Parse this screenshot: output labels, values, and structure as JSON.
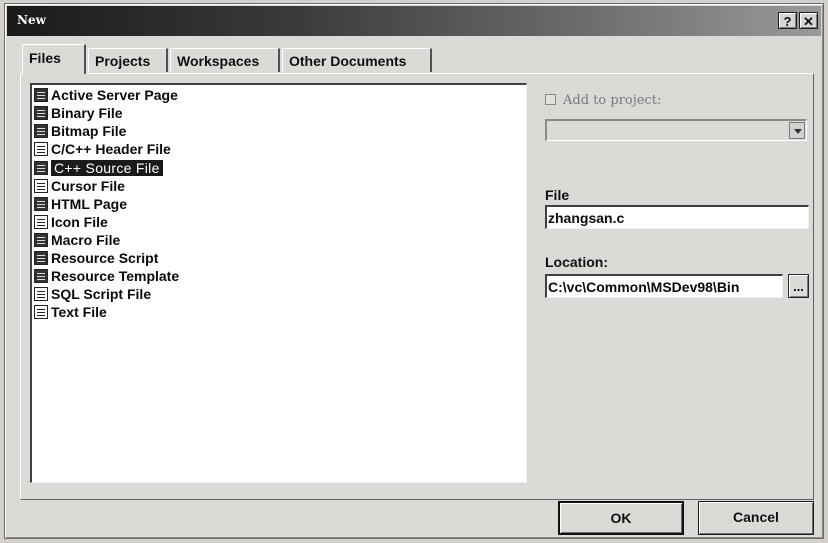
{
  "window": {
    "title": "New"
  },
  "titlebar_buttons": {
    "help": "?",
    "close": "✕"
  },
  "tabs": [
    {
      "label": "Files",
      "active": true
    },
    {
      "label": "Projects",
      "active": false
    },
    {
      "label": "Workspaces",
      "active": false
    },
    {
      "label": "Other Documents",
      "active": false
    }
  ],
  "files": [
    {
      "label": "Active Server Page",
      "icon": "asp-file-icon"
    },
    {
      "label": "Binary File",
      "icon": "binary-file-icon"
    },
    {
      "label": "Bitmap File",
      "icon": "bitmap-file-icon"
    },
    {
      "label": "C/C++ Header File",
      "icon": "header-file-icon"
    },
    {
      "label": "C++ Source File",
      "icon": "cpp-source-file-icon",
      "selected": true
    },
    {
      "label": "Cursor File",
      "icon": "cursor-file-icon"
    },
    {
      "label": "HTML Page",
      "icon": "html-page-icon"
    },
    {
      "label": "Icon File",
      "icon": "icon-file-icon"
    },
    {
      "label": "Macro File",
      "icon": "macro-file-icon"
    },
    {
      "label": "Resource Script",
      "icon": "resource-script-icon"
    },
    {
      "label": "Resource Template",
      "icon": "resource-template-icon"
    },
    {
      "label": "SQL Script File",
      "icon": "sql-script-file-icon"
    },
    {
      "label": "Text File",
      "icon": "text-file-icon"
    }
  ],
  "project": {
    "add_label": "Add to project:",
    "checked": false,
    "value": ""
  },
  "file_field": {
    "label": "File",
    "value": "zhangsan.c"
  },
  "location_field": {
    "label": "Location:",
    "value": "C:\\vc\\Common\\MSDev98\\Bin",
    "browse_label": "..."
  },
  "buttons": {
    "ok": "OK",
    "cancel": "Cancel"
  }
}
